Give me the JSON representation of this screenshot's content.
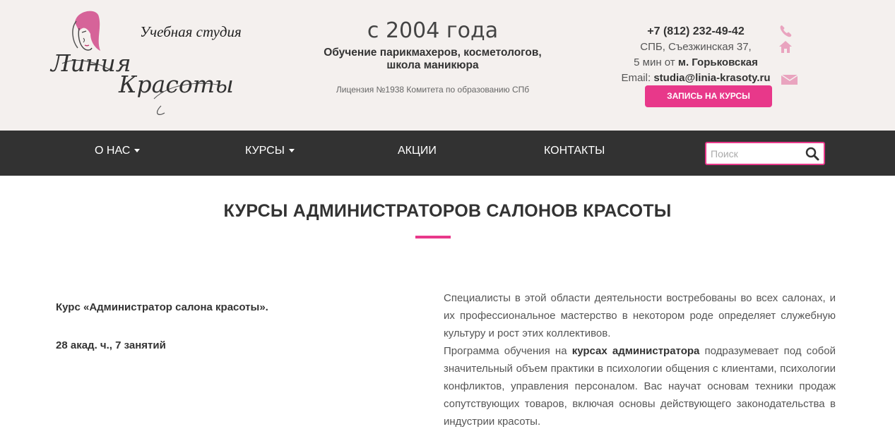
{
  "header": {
    "logo": {
      "studio_text": "Учебная студия",
      "script_line1": "Линия",
      "script_line2": "Красоты"
    },
    "since": "с 2004 года",
    "education_line1": "Обучение парикмахеров, косметологов,",
    "education_line2": "школа маникюра",
    "license": "Лицензия №1938 Комитета по образованию СПб",
    "contacts": {
      "phone": "+7 (812) 232-49-42",
      "address": "СПБ, Съезжинская 37,",
      "metro_prefix": "5 мин от",
      "metro": "м. Горьковская",
      "email_label": "Email:",
      "email": "studia@linia-krasoty.ru"
    },
    "signup_button": "ЗАПИСЬ НА КУРСЫ"
  },
  "nav": {
    "items": [
      {
        "label": "О НАС"
      },
      {
        "label": "КУРСЫ"
      },
      {
        "label": "АКЦИИ"
      },
      {
        "label": "КОНТАКТЫ"
      }
    ],
    "search_placeholder": "Поиск"
  },
  "main": {
    "title": "КУРСЫ АДМИНИСТРАТОРОВ САЛОНОВ КРАСОТЫ",
    "course_name": "Курс «Администратор салона красоты».",
    "course_hours": "28 акад. ч., 7 занятий",
    "para1": "Специалисты в этой области деятельности востребованы во всех салонах, и их профессиональное мастерство в некотором роде определяет служебную культуру и рост этих коллективов.",
    "para2_start": "Программа обучения на",
    "para2_bold": "курсах администратора",
    "para2_end": "подразумевает под собой значительный объем практики в психологии общения с клиентами, психологии конфликтов, управления персоналом. Вас научат основам техники продаж сопутствующих товаров, включая основы действующего законодательства в индустрии красоты."
  },
  "colors": {
    "accent": "#e8388a",
    "nav_bg": "#323232",
    "header_bg": "#f4f0ee",
    "icon_pink": "#e9a4bf"
  },
  "icons": [
    "phone-icon",
    "home-icon",
    "mail-icon",
    "search-icon",
    "caret-down-icon",
    "logo-woman-face"
  ]
}
